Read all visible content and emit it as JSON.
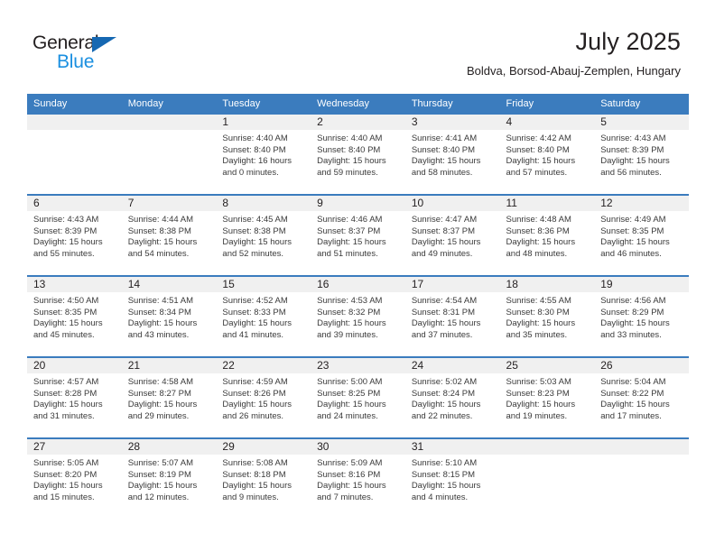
{
  "brand": {
    "name_part1": "General",
    "name_part2": "Blue",
    "color_dark": "#231f20",
    "color_blue": "#1a8fe0",
    "triangle_color": "#1668b2"
  },
  "header": {
    "title": "July 2025",
    "location": "Boldva, Borsod-Abauj-Zemplen, Hungary",
    "accent_color": "#3b7cbe",
    "daynum_bg": "#f0f0f0"
  },
  "weekday_headers": [
    "Sunday",
    "Monday",
    "Tuesday",
    "Wednesday",
    "Thursday",
    "Friday",
    "Saturday"
  ],
  "weeks": [
    [
      {
        "day": "",
        "sunrise": "",
        "sunset": "",
        "daylight_line1": "",
        "daylight_line2": "",
        "empty": true
      },
      {
        "day": "",
        "sunrise": "",
        "sunset": "",
        "daylight_line1": "",
        "daylight_line2": "",
        "empty": true
      },
      {
        "day": "1",
        "sunrise": "Sunrise: 4:40 AM",
        "sunset": "Sunset: 8:40 PM",
        "daylight_line1": "Daylight: 16 hours",
        "daylight_line2": "and 0 minutes."
      },
      {
        "day": "2",
        "sunrise": "Sunrise: 4:40 AM",
        "sunset": "Sunset: 8:40 PM",
        "daylight_line1": "Daylight: 15 hours",
        "daylight_line2": "and 59 minutes."
      },
      {
        "day": "3",
        "sunrise": "Sunrise: 4:41 AM",
        "sunset": "Sunset: 8:40 PM",
        "daylight_line1": "Daylight: 15 hours",
        "daylight_line2": "and 58 minutes."
      },
      {
        "day": "4",
        "sunrise": "Sunrise: 4:42 AM",
        "sunset": "Sunset: 8:40 PM",
        "daylight_line1": "Daylight: 15 hours",
        "daylight_line2": "and 57 minutes."
      },
      {
        "day": "5",
        "sunrise": "Sunrise: 4:43 AM",
        "sunset": "Sunset: 8:39 PM",
        "daylight_line1": "Daylight: 15 hours",
        "daylight_line2": "and 56 minutes."
      }
    ],
    [
      {
        "day": "6",
        "sunrise": "Sunrise: 4:43 AM",
        "sunset": "Sunset: 8:39 PM",
        "daylight_line1": "Daylight: 15 hours",
        "daylight_line2": "and 55 minutes."
      },
      {
        "day": "7",
        "sunrise": "Sunrise: 4:44 AM",
        "sunset": "Sunset: 8:38 PM",
        "daylight_line1": "Daylight: 15 hours",
        "daylight_line2": "and 54 minutes."
      },
      {
        "day": "8",
        "sunrise": "Sunrise: 4:45 AM",
        "sunset": "Sunset: 8:38 PM",
        "daylight_line1": "Daylight: 15 hours",
        "daylight_line2": "and 52 minutes."
      },
      {
        "day": "9",
        "sunrise": "Sunrise: 4:46 AM",
        "sunset": "Sunset: 8:37 PM",
        "daylight_line1": "Daylight: 15 hours",
        "daylight_line2": "and 51 minutes."
      },
      {
        "day": "10",
        "sunrise": "Sunrise: 4:47 AM",
        "sunset": "Sunset: 8:37 PM",
        "daylight_line1": "Daylight: 15 hours",
        "daylight_line2": "and 49 minutes."
      },
      {
        "day": "11",
        "sunrise": "Sunrise: 4:48 AM",
        "sunset": "Sunset: 8:36 PM",
        "daylight_line1": "Daylight: 15 hours",
        "daylight_line2": "and 48 minutes."
      },
      {
        "day": "12",
        "sunrise": "Sunrise: 4:49 AM",
        "sunset": "Sunset: 8:35 PM",
        "daylight_line1": "Daylight: 15 hours",
        "daylight_line2": "and 46 minutes."
      }
    ],
    [
      {
        "day": "13",
        "sunrise": "Sunrise: 4:50 AM",
        "sunset": "Sunset: 8:35 PM",
        "daylight_line1": "Daylight: 15 hours",
        "daylight_line2": "and 45 minutes."
      },
      {
        "day": "14",
        "sunrise": "Sunrise: 4:51 AM",
        "sunset": "Sunset: 8:34 PM",
        "daylight_line1": "Daylight: 15 hours",
        "daylight_line2": "and 43 minutes."
      },
      {
        "day": "15",
        "sunrise": "Sunrise: 4:52 AM",
        "sunset": "Sunset: 8:33 PM",
        "daylight_line1": "Daylight: 15 hours",
        "daylight_line2": "and 41 minutes."
      },
      {
        "day": "16",
        "sunrise": "Sunrise: 4:53 AM",
        "sunset": "Sunset: 8:32 PM",
        "daylight_line1": "Daylight: 15 hours",
        "daylight_line2": "and 39 minutes."
      },
      {
        "day": "17",
        "sunrise": "Sunrise: 4:54 AM",
        "sunset": "Sunset: 8:31 PM",
        "daylight_line1": "Daylight: 15 hours",
        "daylight_line2": "and 37 minutes."
      },
      {
        "day": "18",
        "sunrise": "Sunrise: 4:55 AM",
        "sunset": "Sunset: 8:30 PM",
        "daylight_line1": "Daylight: 15 hours",
        "daylight_line2": "and 35 minutes."
      },
      {
        "day": "19",
        "sunrise": "Sunrise: 4:56 AM",
        "sunset": "Sunset: 8:29 PM",
        "daylight_line1": "Daylight: 15 hours",
        "daylight_line2": "and 33 minutes."
      }
    ],
    [
      {
        "day": "20",
        "sunrise": "Sunrise: 4:57 AM",
        "sunset": "Sunset: 8:28 PM",
        "daylight_line1": "Daylight: 15 hours",
        "daylight_line2": "and 31 minutes."
      },
      {
        "day": "21",
        "sunrise": "Sunrise: 4:58 AM",
        "sunset": "Sunset: 8:27 PM",
        "daylight_line1": "Daylight: 15 hours",
        "daylight_line2": "and 29 minutes."
      },
      {
        "day": "22",
        "sunrise": "Sunrise: 4:59 AM",
        "sunset": "Sunset: 8:26 PM",
        "daylight_line1": "Daylight: 15 hours",
        "daylight_line2": "and 26 minutes."
      },
      {
        "day": "23",
        "sunrise": "Sunrise: 5:00 AM",
        "sunset": "Sunset: 8:25 PM",
        "daylight_line1": "Daylight: 15 hours",
        "daylight_line2": "and 24 minutes."
      },
      {
        "day": "24",
        "sunrise": "Sunrise: 5:02 AM",
        "sunset": "Sunset: 8:24 PM",
        "daylight_line1": "Daylight: 15 hours",
        "daylight_line2": "and 22 minutes."
      },
      {
        "day": "25",
        "sunrise": "Sunrise: 5:03 AM",
        "sunset": "Sunset: 8:23 PM",
        "daylight_line1": "Daylight: 15 hours",
        "daylight_line2": "and 19 minutes."
      },
      {
        "day": "26",
        "sunrise": "Sunrise: 5:04 AM",
        "sunset": "Sunset: 8:22 PM",
        "daylight_line1": "Daylight: 15 hours",
        "daylight_line2": "and 17 minutes."
      }
    ],
    [
      {
        "day": "27",
        "sunrise": "Sunrise: 5:05 AM",
        "sunset": "Sunset: 8:20 PM",
        "daylight_line1": "Daylight: 15 hours",
        "daylight_line2": "and 15 minutes."
      },
      {
        "day": "28",
        "sunrise": "Sunrise: 5:07 AM",
        "sunset": "Sunset: 8:19 PM",
        "daylight_line1": "Daylight: 15 hours",
        "daylight_line2": "and 12 minutes."
      },
      {
        "day": "29",
        "sunrise": "Sunrise: 5:08 AM",
        "sunset": "Sunset: 8:18 PM",
        "daylight_line1": "Daylight: 15 hours",
        "daylight_line2": "and 9 minutes."
      },
      {
        "day": "30",
        "sunrise": "Sunrise: 5:09 AM",
        "sunset": "Sunset: 8:16 PM",
        "daylight_line1": "Daylight: 15 hours",
        "daylight_line2": "and 7 minutes."
      },
      {
        "day": "31",
        "sunrise": "Sunrise: 5:10 AM",
        "sunset": "Sunset: 8:15 PM",
        "daylight_line1": "Daylight: 15 hours",
        "daylight_line2": "and 4 minutes."
      },
      {
        "day": "",
        "sunrise": "",
        "sunset": "",
        "daylight_line1": "",
        "daylight_line2": "",
        "empty": true
      },
      {
        "day": "",
        "sunrise": "",
        "sunset": "",
        "daylight_line1": "",
        "daylight_line2": "",
        "empty": true
      }
    ]
  ]
}
